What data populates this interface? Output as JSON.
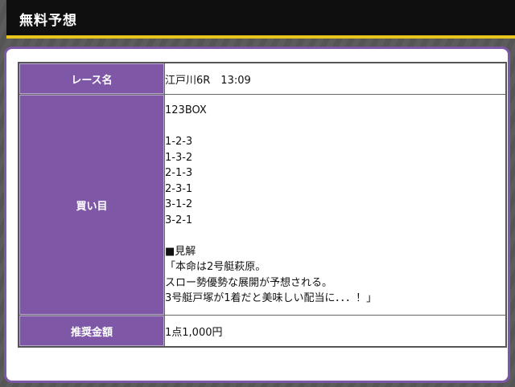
{
  "header": {
    "title": "無料予想"
  },
  "rows": {
    "race": {
      "label": "レース名",
      "value": "江戸川6R　13:09"
    },
    "bets": {
      "label": "買い目",
      "type": "123BOX",
      "combos": [
        "1-2-3",
        "1-3-2",
        "2-1-3",
        "2-3-1",
        "3-1-2",
        "3-2-1"
      ],
      "commentary_heading": "■見解",
      "commentary": [
        "「本命は2号艇萩原。",
        "スロー勢優勢な展開が予想される。",
        "3号艇戸塚が1着だと美味しい配当に．．．！」"
      ]
    },
    "price": {
      "label": "推奨金額",
      "value": "1点1,000円"
    }
  },
  "colors": {
    "header_bg": "#0f0f0f",
    "accent_yellow": "#e7c51c",
    "label_purple": "#7e58a6"
  }
}
